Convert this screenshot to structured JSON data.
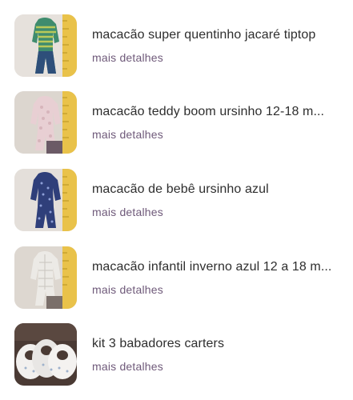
{
  "items": [
    {
      "title": "macacão super quentinho jacaré tiptop",
      "details": "mais detalhes",
      "image": "green-knit-baby-romper-photo"
    },
    {
      "title": "macacão teddy boom ursinho 12-18 m...",
      "details": "mais detalhes",
      "image": "pink-teddy-baby-romper-photo"
    },
    {
      "title": "macacão de bebê ursinho azul",
      "details": "mais detalhes",
      "image": "navy-bear-baby-romper-photo"
    },
    {
      "title": "macacão infantil inverno azul 12 a 18 m...",
      "details": "mais detalhes",
      "image": "light-gray-winter-romper-photo"
    },
    {
      "title": "kit 3 babadores carters",
      "details": "mais detalhes",
      "image": "white-bibs-photo"
    }
  ],
  "colors": {
    "title_text": "#2e2e2e",
    "details_link": "#6f5a7a",
    "background": "#ffffff"
  }
}
